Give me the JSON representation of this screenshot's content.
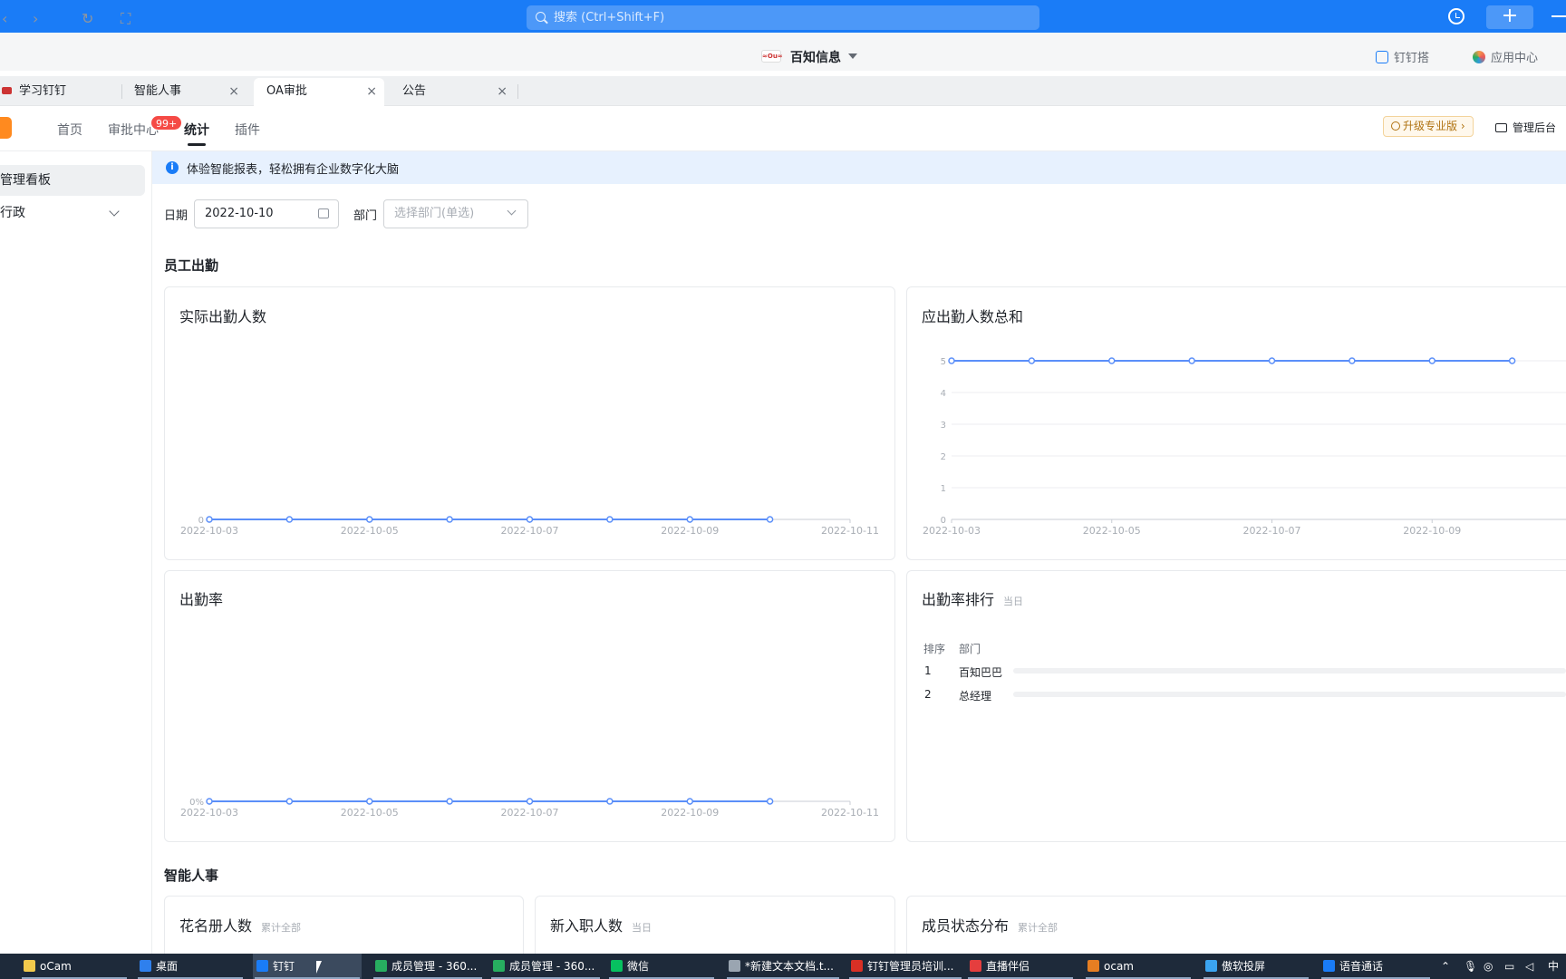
{
  "titlebar": {
    "search_placeholder": "搜索 (Ctrl+Shift+F)"
  },
  "org": {
    "name": "百知信息",
    "logo_text": "≈Ou≈"
  },
  "nav_right": {
    "dingda": "钉钉搭",
    "app_center": "应用中心"
  },
  "tabs": [
    {
      "label": "学习钉钉"
    },
    {
      "label": "智能人事",
      "close": "×"
    },
    {
      "label": "OA审批",
      "close": "×"
    },
    {
      "label": "公告",
      "close": "×"
    }
  ],
  "app_tabs": [
    {
      "label": "首页"
    },
    {
      "label": "审批中心"
    },
    {
      "label": "统计"
    },
    {
      "label": "插件"
    }
  ],
  "badge": "99+",
  "header_right": {
    "upgrade": "升级专业版 ›",
    "admin": "管理后台"
  },
  "sidebar": {
    "items": [
      {
        "label": "管理看板"
      },
      {
        "label": "行政"
      }
    ]
  },
  "banner": {
    "text": "体验智能报表，轻松拥有企业数字化大脑",
    "icon": "i"
  },
  "filters": {
    "date_label": "日期",
    "date_value": "2022-10-10",
    "dept_label": "部门",
    "dept_placeholder": "选择部门(单选)"
  },
  "sections": {
    "attendance": "员工出勤",
    "hr": "智能人事"
  },
  "cards": {
    "actual": {
      "title": "实际出勤人数"
    },
    "expected": {
      "title": "应出勤人数总和"
    },
    "rate": {
      "title": "出勤率"
    },
    "ranking": {
      "title": "出勤率排行",
      "sub": "当日",
      "col_rank": "排序",
      "col_dept": "部门",
      "rows": [
        {
          "rank": "1",
          "dept": "百知巴巴"
        },
        {
          "rank": "2",
          "dept": "总经理"
        }
      ]
    },
    "roster": {
      "title": "花名册人数",
      "sub": "累计全部"
    },
    "newhire": {
      "title": "新入职人数",
      "sub": "当日"
    },
    "status": {
      "title": "成员状态分布",
      "sub": "累计全部"
    }
  },
  "chart_data": [
    {
      "type": "line",
      "title": "实际出勤人数",
      "x": [
        "2022-10-03",
        "2022-10-04",
        "2022-10-05",
        "2022-10-06",
        "2022-10-07",
        "2022-10-08",
        "2022-10-09",
        "2022-10-10"
      ],
      "x_tick_labels": [
        "2022-10-03",
        "2022-10-05",
        "2022-10-07",
        "2022-10-09",
        "2022-10-11"
      ],
      "y_tick_labels": [
        "0"
      ],
      "values": [
        0,
        0,
        0,
        0,
        0,
        0,
        0,
        0
      ],
      "color": "#5b8ff9"
    },
    {
      "type": "line",
      "title": "应出勤人数总和",
      "x": [
        "2022-10-03",
        "2022-10-04",
        "2022-10-05",
        "2022-10-06",
        "2022-10-07",
        "2022-10-08",
        "2022-10-09",
        "2022-10-10"
      ],
      "x_tick_labels": [
        "2022-10-03",
        "2022-10-05",
        "2022-10-07",
        "2022-10-09"
      ],
      "y_tick_labels": [
        "0",
        "1",
        "2",
        "3",
        "4",
        "5"
      ],
      "ylim": [
        0,
        5
      ],
      "values": [
        5,
        5,
        5,
        5,
        5,
        5,
        5,
        5
      ],
      "color": "#5b8ff9"
    },
    {
      "type": "line",
      "title": "出勤率",
      "x": [
        "2022-10-03",
        "2022-10-04",
        "2022-10-05",
        "2022-10-06",
        "2022-10-07",
        "2022-10-08",
        "2022-10-09",
        "2022-10-10"
      ],
      "x_tick_labels": [
        "2022-10-03",
        "2022-10-05",
        "2022-10-07",
        "2022-10-09",
        "2022-10-11"
      ],
      "y_tick_labels": [
        "0%"
      ],
      "values": [
        0,
        0,
        0,
        0,
        0,
        0,
        0,
        0
      ],
      "color": "#5b8ff9"
    }
  ],
  "taskbar": {
    "items": [
      {
        "label": "oCam",
        "color": "#f2c94c"
      },
      {
        "label": "桌面",
        "color": "#2f80ed"
      },
      {
        "label": "钉钉",
        "color": "#1a7cf7"
      },
      {
        "label": "成员管理 - 360...",
        "color": "#27ae60"
      },
      {
        "label": "成员管理 - 360...",
        "color": "#27ae60"
      },
      {
        "label": "微信",
        "color": "#07c160"
      },
      {
        "label": "*新建文本文档.t...",
        "color": "#9aa5b1"
      },
      {
        "label": "钉钉管理员培训...",
        "color": "#d93025"
      },
      {
        "label": "直播伴侣",
        "color": "#e53e3e"
      },
      {
        "label": "ocam",
        "color": "#e67e22"
      },
      {
        "label": "傲软投屏",
        "color": "#3ba4f0"
      },
      {
        "label": "语音通话",
        "color": "#1a7cf7"
      }
    ],
    "tray_text": "中"
  }
}
